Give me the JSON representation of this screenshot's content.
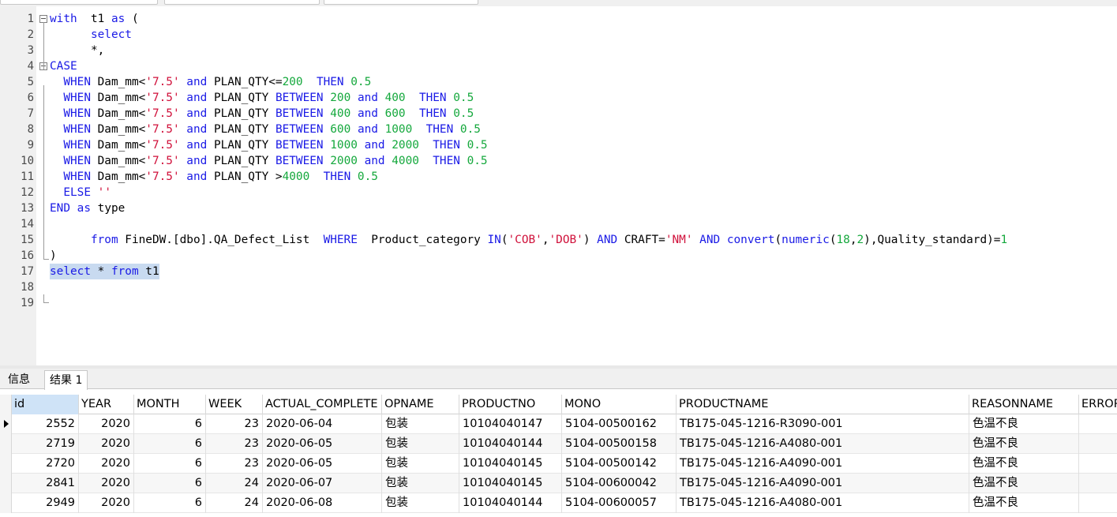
{
  "editor": {
    "lines": [
      {
        "n": "1",
        "fold": true,
        "segs": [
          [
            "kw",
            "with"
          ],
          [
            "",
            "  t1 "
          ],
          [
            "kw",
            "as"
          ],
          [
            "",
            " ("
          ]
        ]
      },
      {
        "n": "2",
        "segs": [
          [
            "",
            "      "
          ],
          [
            "kw",
            "select"
          ]
        ]
      },
      {
        "n": "3",
        "segs": [
          [
            "",
            "      *,"
          ]
        ]
      },
      {
        "n": "4",
        "fold": true,
        "segs": [
          [
            "kw",
            "CASE"
          ]
        ]
      },
      {
        "n": "5",
        "segs": [
          [
            "",
            "  "
          ],
          [
            "kw",
            "WHEN"
          ],
          [
            "",
            " Dam_mm<"
          ],
          [
            "str",
            "'7.5'"
          ],
          [
            "",
            " "
          ],
          [
            "kw",
            "and"
          ],
          [
            "",
            " PLAN_QTY<="
          ],
          [
            "num",
            "200"
          ],
          [
            "",
            "  "
          ],
          [
            "kw",
            "THEN"
          ],
          [
            "",
            " "
          ],
          [
            "num",
            "0.5"
          ]
        ]
      },
      {
        "n": "6",
        "segs": [
          [
            "",
            "  "
          ],
          [
            "kw",
            "WHEN"
          ],
          [
            "",
            " Dam_mm<"
          ],
          [
            "str",
            "'7.5'"
          ],
          [
            "",
            " "
          ],
          [
            "kw",
            "and"
          ],
          [
            "",
            " PLAN_QTY "
          ],
          [
            "kw",
            "BETWEEN"
          ],
          [
            "",
            " "
          ],
          [
            "num",
            "200"
          ],
          [
            "",
            " "
          ],
          [
            "kw",
            "and"
          ],
          [
            "",
            " "
          ],
          [
            "num",
            "400"
          ],
          [
            "",
            "  "
          ],
          [
            "kw",
            "THEN"
          ],
          [
            "",
            " "
          ],
          [
            "num",
            "0.5"
          ]
        ]
      },
      {
        "n": "7",
        "segs": [
          [
            "",
            "  "
          ],
          [
            "kw",
            "WHEN"
          ],
          [
            "",
            " Dam_mm<"
          ],
          [
            "str",
            "'7.5'"
          ],
          [
            "",
            " "
          ],
          [
            "kw",
            "and"
          ],
          [
            "",
            " PLAN_QTY "
          ],
          [
            "kw",
            "BETWEEN"
          ],
          [
            "",
            " "
          ],
          [
            "num",
            "400"
          ],
          [
            "",
            " "
          ],
          [
            "kw",
            "and"
          ],
          [
            "",
            " "
          ],
          [
            "num",
            "600"
          ],
          [
            "",
            "  "
          ],
          [
            "kw",
            "THEN"
          ],
          [
            "",
            " "
          ],
          [
            "num",
            "0.5"
          ]
        ]
      },
      {
        "n": "8",
        "segs": [
          [
            "",
            "  "
          ],
          [
            "kw",
            "WHEN"
          ],
          [
            "",
            " Dam_mm<"
          ],
          [
            "str",
            "'7.5'"
          ],
          [
            "",
            " "
          ],
          [
            "kw",
            "and"
          ],
          [
            "",
            " PLAN_QTY "
          ],
          [
            "kw",
            "BETWEEN"
          ],
          [
            "",
            " "
          ],
          [
            "num",
            "600"
          ],
          [
            "",
            " "
          ],
          [
            "kw",
            "and"
          ],
          [
            "",
            " "
          ],
          [
            "num",
            "1000"
          ],
          [
            "",
            "  "
          ],
          [
            "kw",
            "THEN"
          ],
          [
            "",
            " "
          ],
          [
            "num",
            "0.5"
          ]
        ]
      },
      {
        "n": "9",
        "segs": [
          [
            "",
            "  "
          ],
          [
            "kw",
            "WHEN"
          ],
          [
            "",
            " Dam_mm<"
          ],
          [
            "str",
            "'7.5'"
          ],
          [
            "",
            " "
          ],
          [
            "kw",
            "and"
          ],
          [
            "",
            " PLAN_QTY "
          ],
          [
            "kw",
            "BETWEEN"
          ],
          [
            "",
            " "
          ],
          [
            "num",
            "1000"
          ],
          [
            "",
            " "
          ],
          [
            "kw",
            "and"
          ],
          [
            "",
            " "
          ],
          [
            "num",
            "2000"
          ],
          [
            "",
            "  "
          ],
          [
            "kw",
            "THEN"
          ],
          [
            "",
            " "
          ],
          [
            "num",
            "0.5"
          ]
        ]
      },
      {
        "n": "10",
        "segs": [
          [
            "",
            "  "
          ],
          [
            "kw",
            "WHEN"
          ],
          [
            "",
            " Dam_mm<"
          ],
          [
            "str",
            "'7.5'"
          ],
          [
            "",
            " "
          ],
          [
            "kw",
            "and"
          ],
          [
            "",
            " PLAN_QTY "
          ],
          [
            "kw",
            "BETWEEN"
          ],
          [
            "",
            " "
          ],
          [
            "num",
            "2000"
          ],
          [
            "",
            " "
          ],
          [
            "kw",
            "and"
          ],
          [
            "",
            " "
          ],
          [
            "num",
            "4000"
          ],
          [
            "",
            "  "
          ],
          [
            "kw",
            "THEN"
          ],
          [
            "",
            " "
          ],
          [
            "num",
            "0.5"
          ]
        ]
      },
      {
        "n": "11",
        "segs": [
          [
            "",
            "  "
          ],
          [
            "kw",
            "WHEN"
          ],
          [
            "",
            " Dam_mm<"
          ],
          [
            "str",
            "'7.5'"
          ],
          [
            "",
            " "
          ],
          [
            "kw",
            "and"
          ],
          [
            "",
            " PLAN_QTY >"
          ],
          [
            "num",
            "4000"
          ],
          [
            "",
            "  "
          ],
          [
            "kw",
            "THEN"
          ],
          [
            "",
            " "
          ],
          [
            "num",
            "0.5"
          ]
        ]
      },
      {
        "n": "12",
        "segs": [
          [
            "",
            "  "
          ],
          [
            "kw",
            "ELSE"
          ],
          [
            "",
            " "
          ],
          [
            "str",
            "''"
          ]
        ]
      },
      {
        "n": "13",
        "segs": [
          [
            "kw",
            "END"
          ],
          [
            "",
            " "
          ],
          [
            "kw",
            "as"
          ],
          [
            "",
            " type"
          ]
        ]
      },
      {
        "n": "14",
        "segs": []
      },
      {
        "n": "15",
        "segs": [
          [
            "",
            "      "
          ],
          [
            "kw",
            "from"
          ],
          [
            "",
            " FineDW.[dbo].QA_Defect_List  "
          ],
          [
            "kw",
            "WHERE"
          ],
          [
            "",
            "  Product_category "
          ],
          [
            "kw",
            "IN"
          ],
          [
            "",
            "("
          ],
          [
            "str",
            "'COB'"
          ],
          [
            "",
            ","
          ],
          [
            "str",
            "'DOB'"
          ],
          [
            "",
            ") "
          ],
          [
            "kw",
            "AND"
          ],
          [
            "",
            " CRAFT="
          ],
          [
            "str",
            "'NM'"
          ],
          [
            "",
            " "
          ],
          [
            "kw",
            "AND"
          ],
          [
            "",
            " "
          ],
          [
            "kw",
            "convert"
          ],
          [
            "",
            "("
          ],
          [
            "kw",
            "numeric"
          ],
          [
            "",
            "("
          ],
          [
            "num",
            "18"
          ],
          [
            "",
            ","
          ],
          [
            "num",
            "2"
          ],
          [
            "",
            "),Quality_standard)="
          ],
          [
            "num",
            "1"
          ]
        ]
      },
      {
        "n": "16",
        "segs": [
          [
            "",
            ")"
          ]
        ]
      },
      {
        "n": "17",
        "selected": true,
        "segs": [
          [
            "kw",
            "select"
          ],
          [
            "",
            " * "
          ],
          [
            "kw",
            "from"
          ],
          [
            "",
            " t1"
          ]
        ]
      },
      {
        "n": "18",
        "segs": []
      },
      {
        "n": "19",
        "segs": []
      }
    ]
  },
  "tabs": [
    {
      "label": "信息",
      "active": false
    },
    {
      "label": "结果 1",
      "active": true
    }
  ],
  "grid": {
    "columns": [
      {
        "label": "id",
        "align": "r"
      },
      {
        "label": "YEAR",
        "align": "r"
      },
      {
        "label": "MONTH",
        "align": "r"
      },
      {
        "label": "WEEK",
        "align": "r"
      },
      {
        "label": "ACTUAL_COMPLETE",
        "align": "l"
      },
      {
        "label": "OPNAME",
        "align": "l"
      },
      {
        "label": "PRODUCTNO",
        "align": "l"
      },
      {
        "label": "MONO",
        "align": "l"
      },
      {
        "label": "PRODUCTNAME",
        "align": "l"
      },
      {
        "label": "REASONNAME",
        "align": "l"
      },
      {
        "label": "ERROR",
        "align": "l"
      }
    ],
    "rows": [
      [
        "2552",
        "2020",
        "6",
        "23",
        "2020-06-04",
        "包装",
        "10104040147",
        "5104-00500162",
        "TB175-045-1216-R3090-001",
        "色温不良",
        ""
      ],
      [
        "2719",
        "2020",
        "6",
        "23",
        "2020-06-05",
        "包装",
        "10104040144",
        "5104-00500158",
        "TB175-045-1216-A4080-001",
        "色温不良",
        ""
      ],
      [
        "2720",
        "2020",
        "6",
        "23",
        "2020-06-05",
        "包装",
        "10104040145",
        "5104-00500142",
        "TB175-045-1216-A4090-001",
        "色温不良",
        ""
      ],
      [
        "2841",
        "2020",
        "6",
        "24",
        "2020-06-07",
        "包装",
        "10104040145",
        "5104-00600042",
        "TB175-045-1216-A4090-001",
        "色温不良",
        ""
      ],
      [
        "2949",
        "2020",
        "6",
        "24",
        "2020-06-08",
        "包装",
        "10104040144",
        "5104-00600057",
        "TB175-045-1216-A4080-001",
        "色温不良",
        ""
      ]
    ]
  }
}
